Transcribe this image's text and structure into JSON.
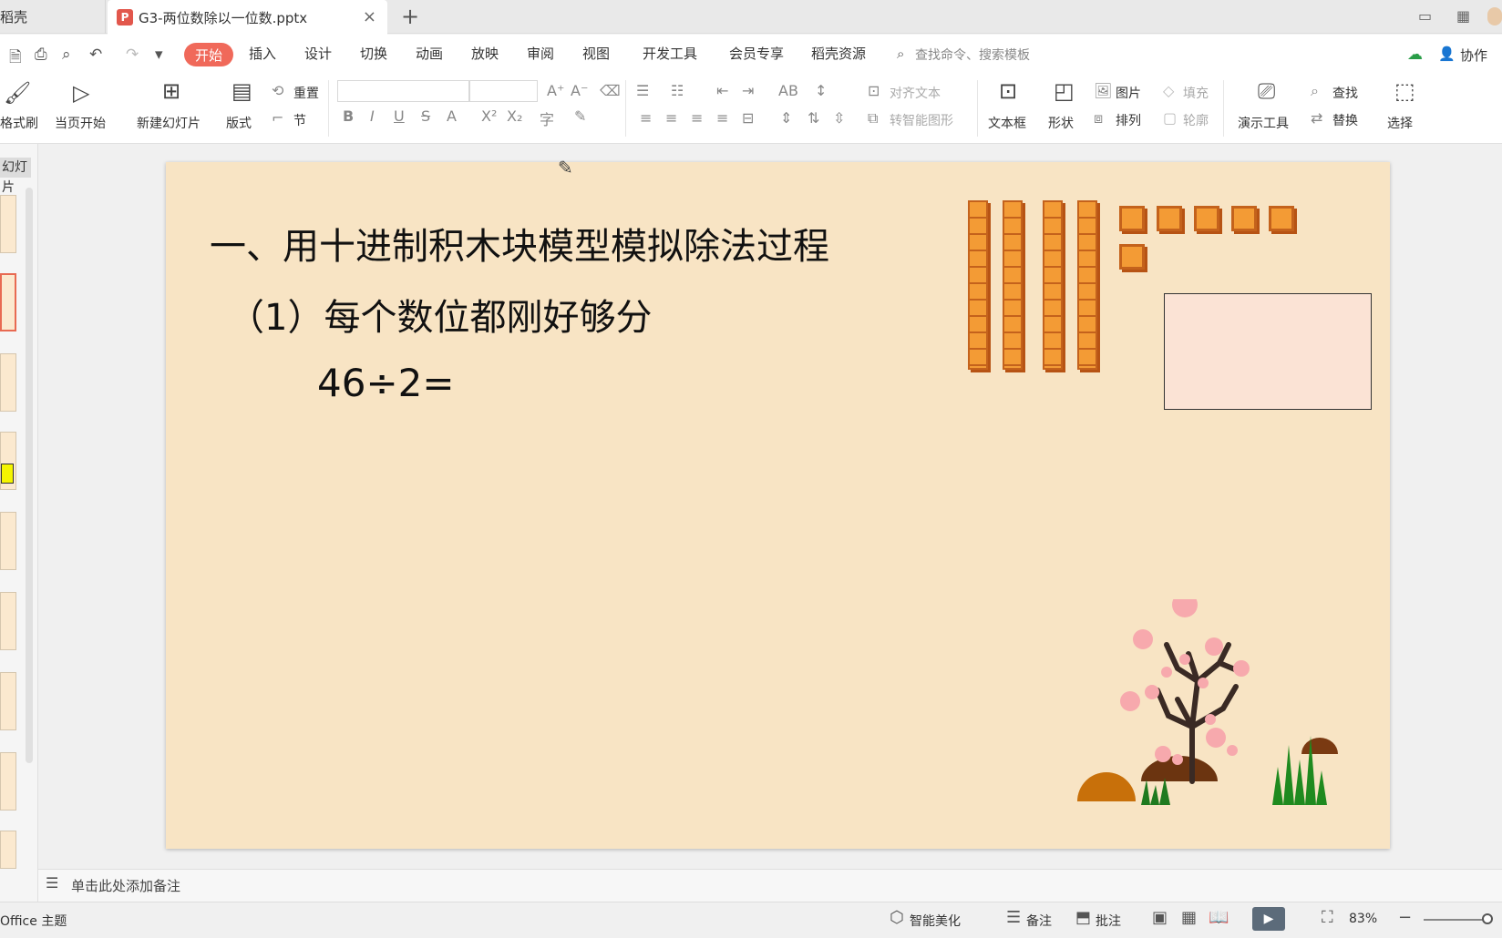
{
  "titlebar": {
    "prev_tab": "稻壳",
    "active_tab": "G3-两位数除以一位数.pptx",
    "ppt_icon": "P",
    "close_glyph": "×",
    "add_glyph": "+"
  },
  "menu": {
    "items": [
      "开始",
      "插入",
      "设计",
      "切换",
      "动画",
      "放映",
      "审阅",
      "视图",
      "开发工具",
      "会员专享",
      "稻壳资源"
    ],
    "search_placeholder": "查找命令、搜索模板",
    "collab": "协作"
  },
  "ribbon": {
    "format_painter": "格式刷",
    "play_from_current": "当页开始",
    "new_slide": "新建幻灯片",
    "layout": "版式",
    "reset": "重置",
    "section": "节",
    "align_text": "对齐文本",
    "smart_shape": "转智能图形",
    "textbox": "文本框",
    "shape": "形状",
    "picture": "图片",
    "arrange": "排列",
    "fill": "填充",
    "outline": "轮廓",
    "present_tools": "演示工具",
    "find": "查找",
    "replace": "替换",
    "select": "选择"
  },
  "leftpanel": {
    "label": "幻灯片"
  },
  "slide": {
    "title": "一、用十进制积木块模型模拟除法过程",
    "subtitle": "（1）每个数位都刚好够分",
    "equation": "46÷2=",
    "tens_rods": 4,
    "ones_cubes": 6
  },
  "notes": {
    "placeholder": "单击此处添加备注"
  },
  "status": {
    "theme": "Office 主题",
    "beautify": "智能美化",
    "notes": "备注",
    "comment": "批注",
    "zoom": "83%"
  },
  "colors": {
    "accent": "#f0695a",
    "slide_bg": "#f8e4c4",
    "block_orange": "#f39b35"
  }
}
